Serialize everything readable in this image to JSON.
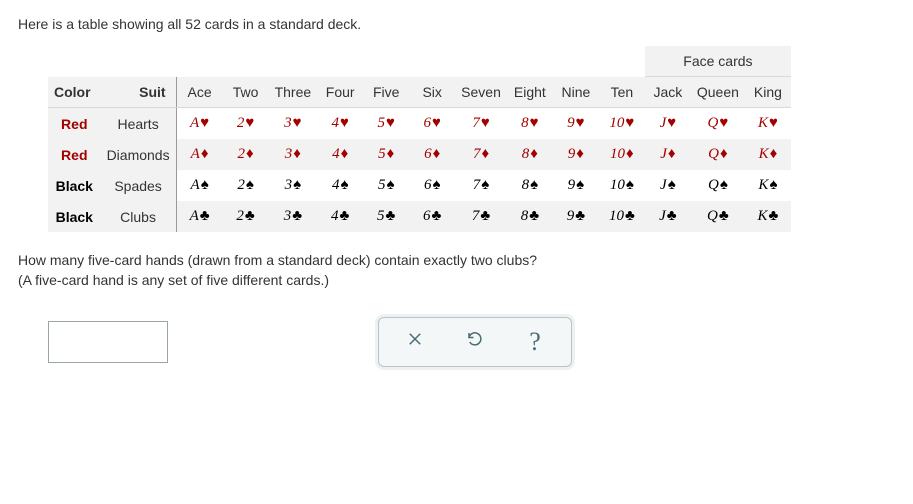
{
  "intro": "Here is a table showing all 52 cards in a standard deck.",
  "headers": {
    "color": "Color",
    "suit": "Suit",
    "face_super": "Face cards",
    "ranks": [
      "Ace",
      "Two",
      "Three",
      "Four",
      "Five",
      "Six",
      "Seven",
      "Eight",
      "Nine",
      "Ten",
      "Jack",
      "Queen",
      "King"
    ]
  },
  "rank_short": [
    "A",
    "2",
    "3",
    "4",
    "5",
    "6",
    "7",
    "8",
    "9",
    "10",
    "J",
    "Q",
    "K"
  ],
  "rows": [
    {
      "color": "Red",
      "suit_name": "Hearts",
      "pip": "♥",
      "css": "red"
    },
    {
      "color": "Red",
      "suit_name": "Diamonds",
      "pip": "♦",
      "css": "red"
    },
    {
      "color": "Black",
      "suit_name": "Spades",
      "pip": "♠",
      "css": "black"
    },
    {
      "color": "Black",
      "suit_name": "Clubs",
      "pip": "♣",
      "css": "black"
    }
  ],
  "question_line1": "How many five-card hands (drawn from a standard deck) contain exactly two clubs?",
  "question_line2": "(A five-card hand is any set of five different cards.)",
  "answer_value": "",
  "answer_placeholder": "",
  "buttons": {
    "clear": "×",
    "reset": "↺",
    "help": "?"
  }
}
